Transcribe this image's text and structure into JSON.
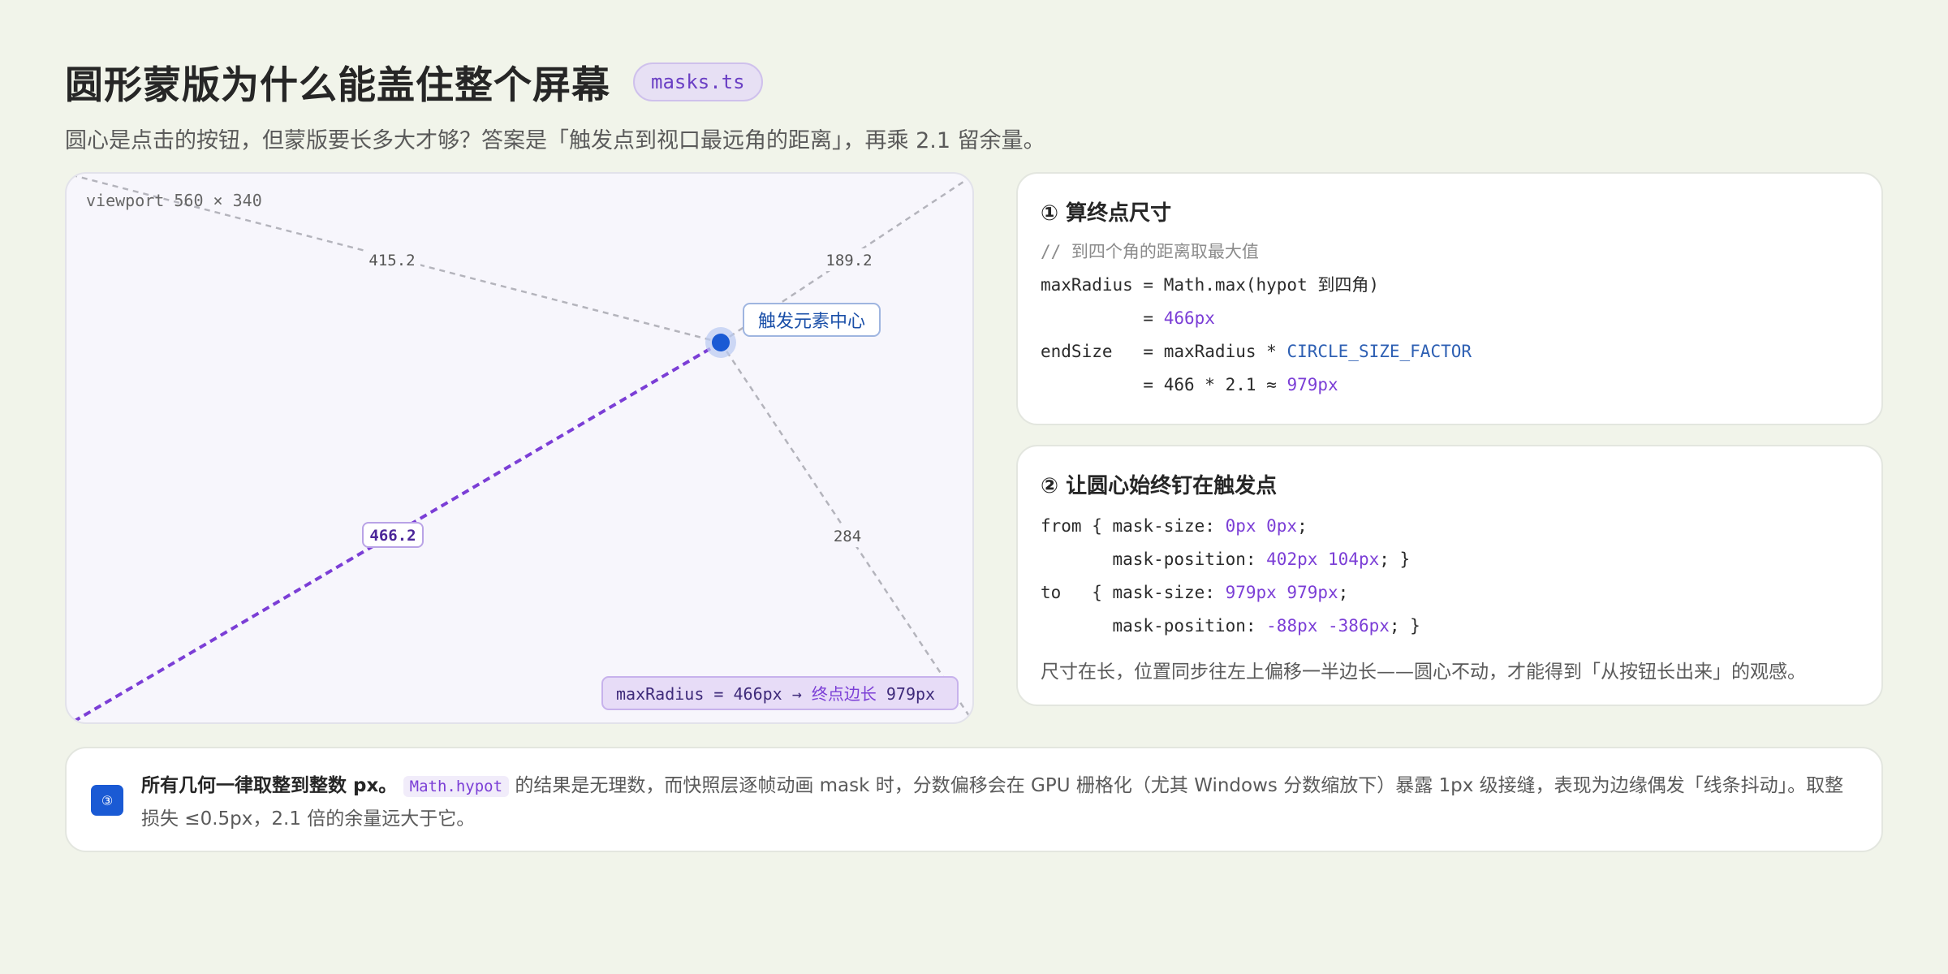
{
  "header": {
    "title": "圆形蒙版为什么能盖住整个屏幕",
    "file_badge": "masks.ts",
    "subtitle": "圆心是点击的按钮，但蒙版要长多大才够？答案是「触发点到视口最远角的距离」，再乘 2.1 留余量。"
  },
  "diagram": {
    "viewport_label": "viewport 560 × 340",
    "distance_labels": {
      "top_left": "415.2",
      "top_right": "189.2",
      "bottom_left": "466.2",
      "bottom_right": "284"
    },
    "trigger_label": "触发元素中心",
    "summary_prefix": "maxRadius = 466px → ",
    "summary_cn": "终点边长",
    "summary_suffix": " 979px",
    "colors": {
      "accent": "#7b3ed6",
      "trigger": "#1a5ad4",
      "line": "#b4b4bc"
    }
  },
  "card1": {
    "title": "① 算终点尺寸",
    "line1": "// 到四个角的距离取最大值",
    "line2": "maxRadius = Math.max(hypot 到四角)",
    "line3_prefix": "          = ",
    "line3_value": "466px",
    "line4_prefix": "endSize   = maxRadius * ",
    "line4_const": "CIRCLE_SIZE_FACTOR",
    "line5_prefix": "          = 466 * 2.1 ≈ ",
    "line5_value": "979px"
  },
  "card2": {
    "title": "② 让圆心始终钉在触发点",
    "l1_a": "from { mask-size: ",
    "l1_v": "0px 0px",
    "l1_b": ";",
    "l2_a": "       mask-position: ",
    "l2_v": "402px 104px",
    "l2_b": "; }",
    "l3_a": "to   { mask-size: ",
    "l3_v": "979px 979px",
    "l3_b": ";",
    "l4_a": "       mask-position: ",
    "l4_v": "-88px -386px",
    "l4_b": "; }",
    "note": "尺寸在长，位置同步往左上偏移一半边长——圆心不动，才能得到「从按钮长出来」的观感。"
  },
  "note": {
    "icon": "③",
    "bold": "所有几何一律取整到整数 px。",
    "code": "Math.hypot",
    "text": " 的结果是无理数，而快照层逐帧动画 mask 时，分数偏移会在 GPU 栅格化（尤其 Windows 分数缩放下）暴露 1px 级接缝，表现为边缘偶发「线条抖动」。取整损失 ≤0.5px，2.1 倍的余量远大于它。"
  }
}
